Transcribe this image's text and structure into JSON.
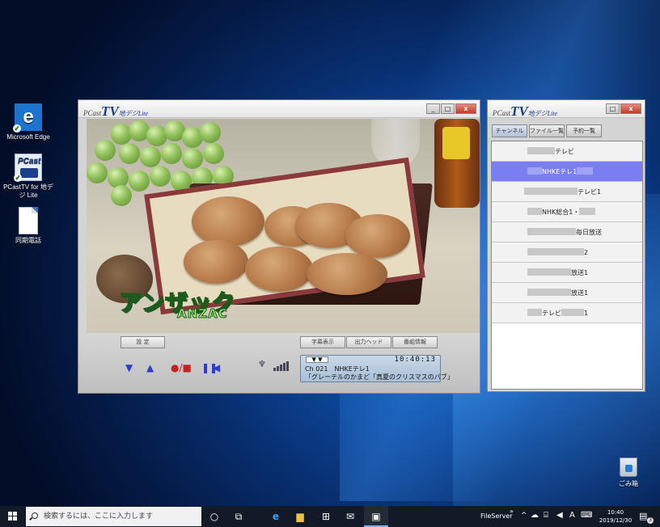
{
  "desktop": {
    "icons": [
      {
        "label": "Microsoft Edge"
      },
      {
        "label": "PCastTV for 地デジ Lite"
      },
      {
        "label": "同期電話"
      }
    ],
    "recycle_bin": "ごみ箱"
  },
  "player": {
    "logo_prefix": "PCast",
    "logo_tv": "TV",
    "logo_suffix": "地デジLite",
    "caption_jp": "アンザック",
    "caption_en": "ANZAC",
    "settings_button": "設 定",
    "subtitle_button": "字幕表示",
    "data_button": "出力ヘッド",
    "program_info_button": "番組情報",
    "info": {
      "badge": "▼ ▼",
      "time": "10:40:13",
      "channel": "Ch 021　NHKEテレ1",
      "program": "「グレーテルのかまど「真夏のクリスマスのパブ」"
    },
    "controls": {
      "ch_down": "▼",
      "ch_up": "▲",
      "record": "●/■",
      "pause": "❚❚",
      "rewind": "◀"
    }
  },
  "channel_window": {
    "logo_prefix": "PCast",
    "logo_tv": "TV",
    "logo_suffix": "地デジLite",
    "tabs": [
      "チャンネル",
      "ファイル一覧",
      "予約一覧"
    ],
    "channels": [
      {
        "pre": "",
        "text": "テレビ",
        "post": ""
      },
      {
        "pre": "",
        "text": "NHKEテレ1",
        "post": ""
      },
      {
        "pre": "",
        "text": "テレビ1",
        "post": ""
      },
      {
        "pre": "",
        "text": "NHK総合1・",
        "post": ""
      },
      {
        "pre": "",
        "text": "毎日放送",
        "post": ""
      },
      {
        "pre": "",
        "text": "2",
        "post": ""
      },
      {
        "pre": "",
        "text": "放送1",
        "post": ""
      },
      {
        "pre": "",
        "text": "放送1",
        "post": ""
      },
      {
        "pre": "",
        "text": "テレビ",
        "post": "1"
      }
    ],
    "selected_index": 1
  },
  "taskbar": {
    "search_placeholder": "検索するには、ここに入力します",
    "fileserver": "FileServer",
    "chevron": "»",
    "ime": "A",
    "time": "10:40",
    "date": "2019/12/30",
    "notif_count": "3"
  }
}
